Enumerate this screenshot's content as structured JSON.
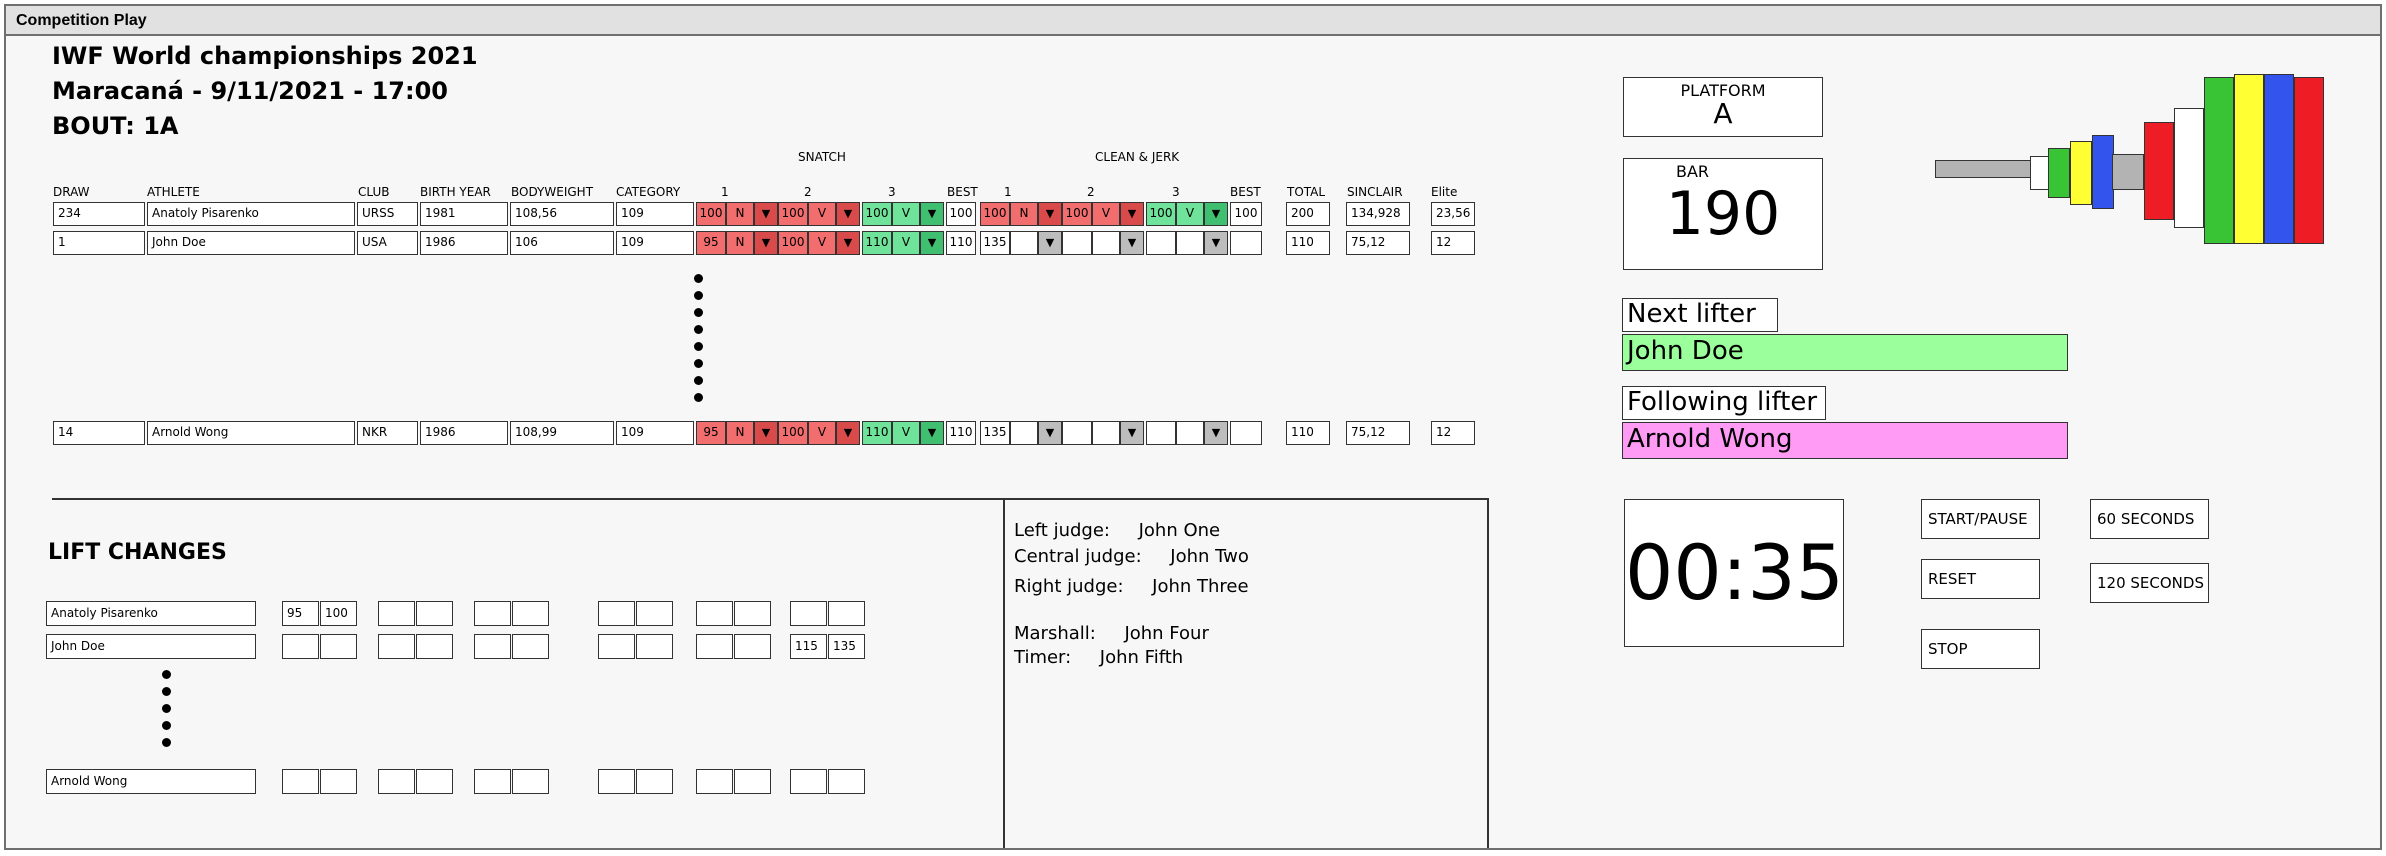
{
  "window": {
    "title": "Competition Play"
  },
  "event": {
    "title": "IWF World championships 2021",
    "venue_date": "Maracaná - 9/11/2021 - 17:00",
    "bout": "BOUT:   1A"
  },
  "table": {
    "group_snatch": "SNATCH",
    "group_cj": "CLEAN & JERK",
    "headers": {
      "draw": "DRAW",
      "athlete": "ATHLETE",
      "club": "CLUB",
      "birth": "BIRTH YEAR",
      "bw": "BODYWEIGHT",
      "cat": "CATEGORY",
      "s1": "1",
      "s2": "2",
      "s3": "3",
      "sbest": "BEST",
      "c1": "1",
      "c2": "2",
      "c3": "3",
      "cbest": "BEST",
      "total": "TOTAL",
      "sinclair": "SINCLAIR",
      "elite": "Elite"
    },
    "rows": [
      {
        "draw": "234",
        "athlete": "Anatoly Pisarenko",
        "club": "URSS",
        "birth": "1981",
        "bw": "108,56",
        "cat": "109",
        "s1w": "100",
        "s1r": "N",
        "s2w": "100",
        "s2r": "V",
        "s3w": "100",
        "s3r": "V",
        "sbest": "100",
        "c1w": "100",
        "c1r": "N",
        "c2w": "100",
        "c2r": "V",
        "c3w": "100",
        "c3r": "V",
        "cbest": "100",
        "total": "200",
        "sinclair": "134,928",
        "elite": "23,56"
      },
      {
        "draw": "1",
        "athlete": "John Doe",
        "club": "USA",
        "birth": "1986",
        "bw": "106",
        "cat": "109",
        "s1w": "95",
        "s1r": "N",
        "s2w": "100",
        "s2r": "V",
        "s3w": "110",
        "s3r": "V",
        "sbest": "110",
        "c1w": "135",
        "c1r": "",
        "c2w": "",
        "c2r": "",
        "c3w": "",
        "c3r": "",
        "cbest": "",
        "total": "110",
        "sinclair": "75,12",
        "elite": "12"
      },
      {
        "draw": "14",
        "athlete": "Arnold Wong",
        "club": "NKR",
        "birth": "1986",
        "bw": "108,99",
        "cat": "109",
        "s1w": "95",
        "s1r": "N",
        "s2w": "100",
        "s2r": "V",
        "s3w": "110",
        "s3r": "V",
        "sbest": "110",
        "c1w": "135",
        "c1r": "",
        "c2w": "",
        "c2r": "",
        "c3w": "",
        "c3r": "",
        "cbest": "",
        "total": "110",
        "sinclair": "75,12",
        "elite": "12"
      }
    ],
    "dropdown_glyph": "▼"
  },
  "lift_changes": {
    "title": "LIFT CHANGES",
    "rows": [
      {
        "name": "Anatoly Pisarenko",
        "a1": "95",
        "a2": "100",
        "f1": "",
        "f2": ""
      },
      {
        "name": "John Doe",
        "a1": "",
        "a2": "",
        "f1": "115",
        "f2": "135"
      },
      {
        "name": "Arnold Wong",
        "a1": "",
        "a2": "",
        "f1": "",
        "f2": ""
      }
    ]
  },
  "officials": {
    "left": "Left judge:     John One",
    "central": "Central judge:     John Two",
    "right": "Right judge:     John Three",
    "marshall": "Marshall:     John Four",
    "timer": "Timer:     John Fifth"
  },
  "platform": {
    "label": "PLATFORM",
    "value": "A"
  },
  "bar": {
    "label": "BAR",
    "value": "190"
  },
  "next": {
    "label": "Next lifter",
    "name": "John Doe",
    "color": "#9bff9b"
  },
  "following": {
    "label": "Following lifter",
    "name": "Arnold Wong",
    "color": "#ff9bf5"
  },
  "timer": {
    "display": "00:35"
  },
  "buttons": {
    "start_pause": "START/PAUSE",
    "reset": "RESET",
    "stop": "STOP",
    "sixty": "60 SECONDS",
    "one_twenty": "120 SECONDS"
  },
  "plate_colors": {
    "red": "#ee1c25",
    "white": "#ffffff",
    "green": "#38c435",
    "yellow": "#ffff33",
    "blue": "#3355ee",
    "grey": "#b3b3b3"
  }
}
